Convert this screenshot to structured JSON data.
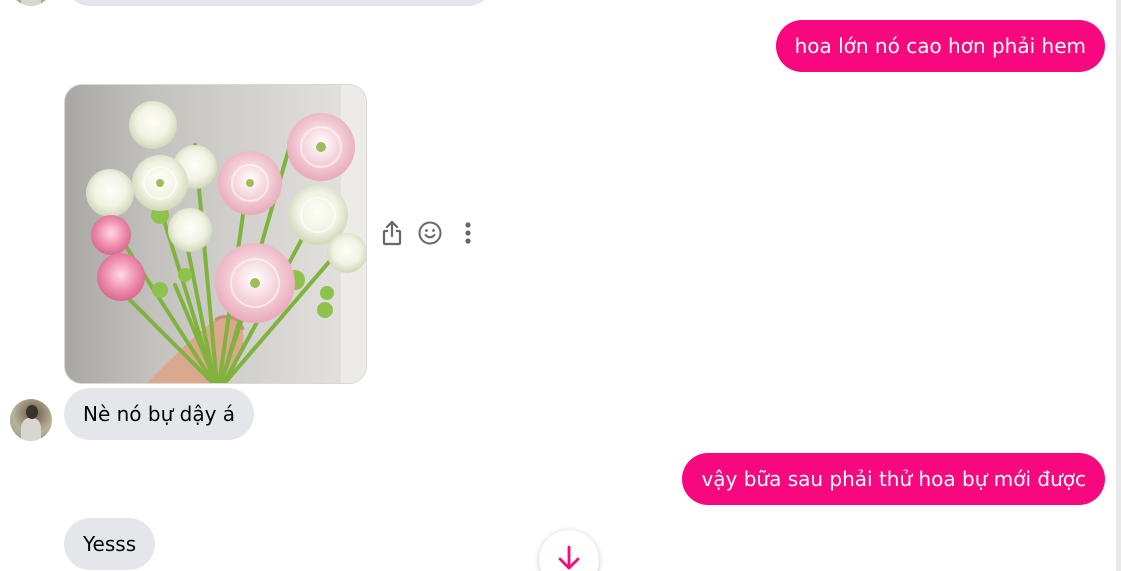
{
  "messages": [
    {
      "id": "m0",
      "from": "them",
      "text": ""
    },
    {
      "id": "m1",
      "from": "me",
      "text": "hoa lớn nó cao hơn phải hem"
    },
    {
      "id": "m2",
      "from": "them",
      "type": "image",
      "image": "flower-bouquet-photo"
    },
    {
      "id": "m3",
      "from": "them",
      "text": "Nè nó bự dậy á"
    },
    {
      "id": "m4",
      "from": "me",
      "text": "vậy bữa sau phải thử hoa bự mới được"
    },
    {
      "id": "m5",
      "from": "them",
      "text": "Yesss"
    }
  ],
  "message_actions": {
    "icons": [
      "share-icon",
      "emoji-icon",
      "more-options-icon"
    ]
  },
  "scroll_down_button": {
    "icon": "arrow-down-icon"
  },
  "colors": {
    "outgoing_bubble": "#f7087f",
    "incoming_bubble": "#e4e6eb",
    "accent": "#f7087f"
  }
}
